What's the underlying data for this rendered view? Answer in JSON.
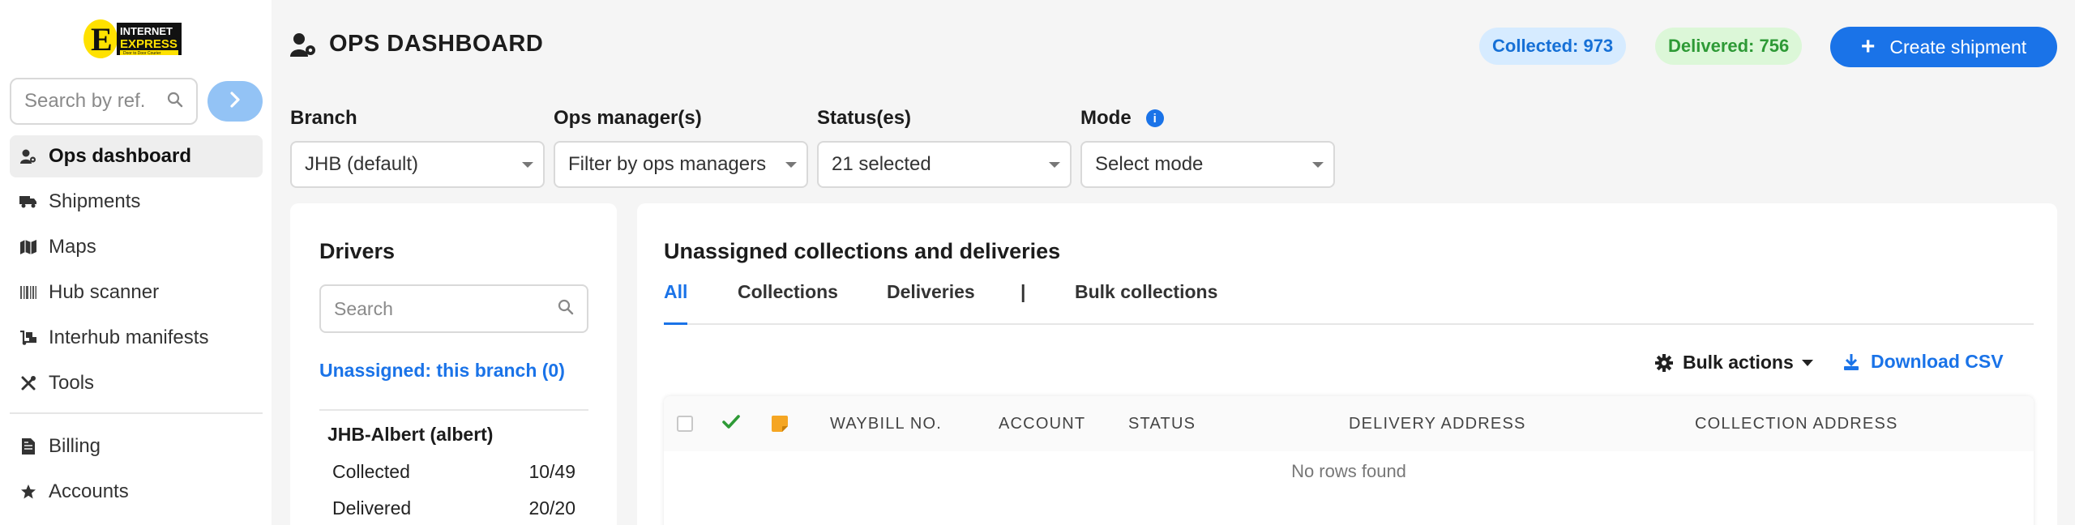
{
  "logo": {
    "line1": "INTERNET",
    "line2": "EXPRESS",
    "tagline": "Door to Door Courier"
  },
  "sidebar": {
    "search_placeholder": "Search by ref.",
    "items": [
      {
        "label": "Ops dashboard",
        "icon": "user-gear-icon",
        "active": true
      },
      {
        "label": "Shipments",
        "icon": "truck-icon"
      },
      {
        "label": "Maps",
        "icon": "map-icon"
      },
      {
        "label": "Hub scanner",
        "icon": "barcode-icon"
      },
      {
        "label": "Interhub manifests",
        "icon": "dolly-icon"
      },
      {
        "label": "Tools",
        "icon": "tools-icon"
      },
      {
        "label": "Billing",
        "icon": "invoice-icon"
      },
      {
        "label": "Accounts",
        "icon": "star-icon"
      }
    ]
  },
  "header": {
    "title": "OPS DASHBOARD",
    "collected_badge": "Collected: 973",
    "delivered_badge": "Delivered: 756",
    "create_button": "Create shipment"
  },
  "filters": {
    "branch": {
      "label": "Branch",
      "value": "JHB (default)"
    },
    "ops_managers": {
      "label": "Ops manager(s)",
      "value": "Filter by ops managers"
    },
    "statuses": {
      "label": "Status(es)",
      "value": "21 selected"
    },
    "mode": {
      "label": "Mode",
      "value": "Select mode"
    }
  },
  "drivers": {
    "title": "Drivers",
    "search_placeholder": "Search",
    "unassigned_link": "Unassigned: this branch (0)",
    "driver": {
      "name": "JHB-Albert (albert)",
      "collected_label": "Collected",
      "collected_value": "10/49",
      "delivered_label": "Delivered",
      "delivered_value": "20/20"
    }
  },
  "main": {
    "title": "Unassigned collections and deliveries",
    "tabs": [
      "All",
      "Collections",
      "Deliveries",
      "|",
      "Bulk collections"
    ],
    "bulk_actions": "Bulk actions",
    "download_csv": "Download CSV",
    "table": {
      "columns": [
        "WAYBILL NO.",
        "ACCOUNT",
        "STATUS",
        "DELIVERY ADDRESS",
        "COLLECTION ADDRESS"
      ],
      "empty_text": "No rows found"
    }
  },
  "colors": {
    "accent": "#1a73e8",
    "collected_bg": "#d6ebff",
    "delivered_bg": "#dcf7d8",
    "check_green": "#2e9a36",
    "note_orange": "#f5a623"
  }
}
